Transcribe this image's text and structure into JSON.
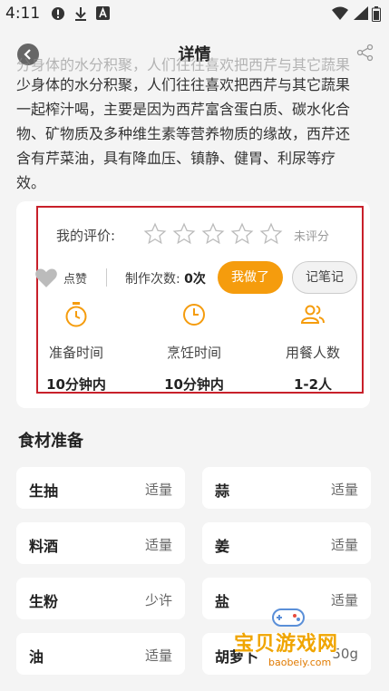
{
  "status_bar": {
    "time": "4:11"
  },
  "header": {
    "title": "详情"
  },
  "description": {
    "faded_line": "分身体的水分积聚，人们往往喜欢把西芹与其它蔬果",
    "lines": [
      "少身体的水分积聚，人们往往喜欢把西芹与其它蔬果",
      "一起榨汁喝，主要是因为西芹富含蛋白质、碳水化合",
      "物、矿物质及多种维生素等营养物质的缘故，西芹还",
      "含有芹菜油，具有降血压、镇静、健胃、利尿等疗",
      "效。"
    ]
  },
  "rating": {
    "label": "我的评价:",
    "status": "未评分",
    "stars": 5,
    "value": 0
  },
  "actions": {
    "like_label": "点赞",
    "count_label": "制作次数:",
    "count_value": "0次",
    "did_it_label": "我做了",
    "note_label": "记笔记"
  },
  "stats": [
    {
      "label": "准备时间",
      "value": "10分钟内",
      "icon": "stopwatch-icon"
    },
    {
      "label": "烹饪时间",
      "value": "10分钟内",
      "icon": "clock-icon"
    },
    {
      "label": "用餐人数",
      "value": "1-2人",
      "icon": "people-icon"
    }
  ],
  "ingredients_section": {
    "title": "食材准备",
    "items": [
      {
        "name": "生抽",
        "amount": "适量"
      },
      {
        "name": "蒜",
        "amount": "适量"
      },
      {
        "name": "料酒",
        "amount": "适量"
      },
      {
        "name": "姜",
        "amount": "适量"
      },
      {
        "name": "生粉",
        "amount": "少许"
      },
      {
        "name": "盐",
        "amount": "适量"
      },
      {
        "name": "油",
        "amount": "适量"
      },
      {
        "name": "胡萝卜",
        "amount": "50g"
      }
    ]
  },
  "watermark": {
    "text": "宝贝游戏网",
    "url": "baobeiy.com"
  },
  "colors": {
    "accent": "#f59c0d",
    "highlight_box": "#c8202a",
    "background": "#f4f4f4"
  }
}
